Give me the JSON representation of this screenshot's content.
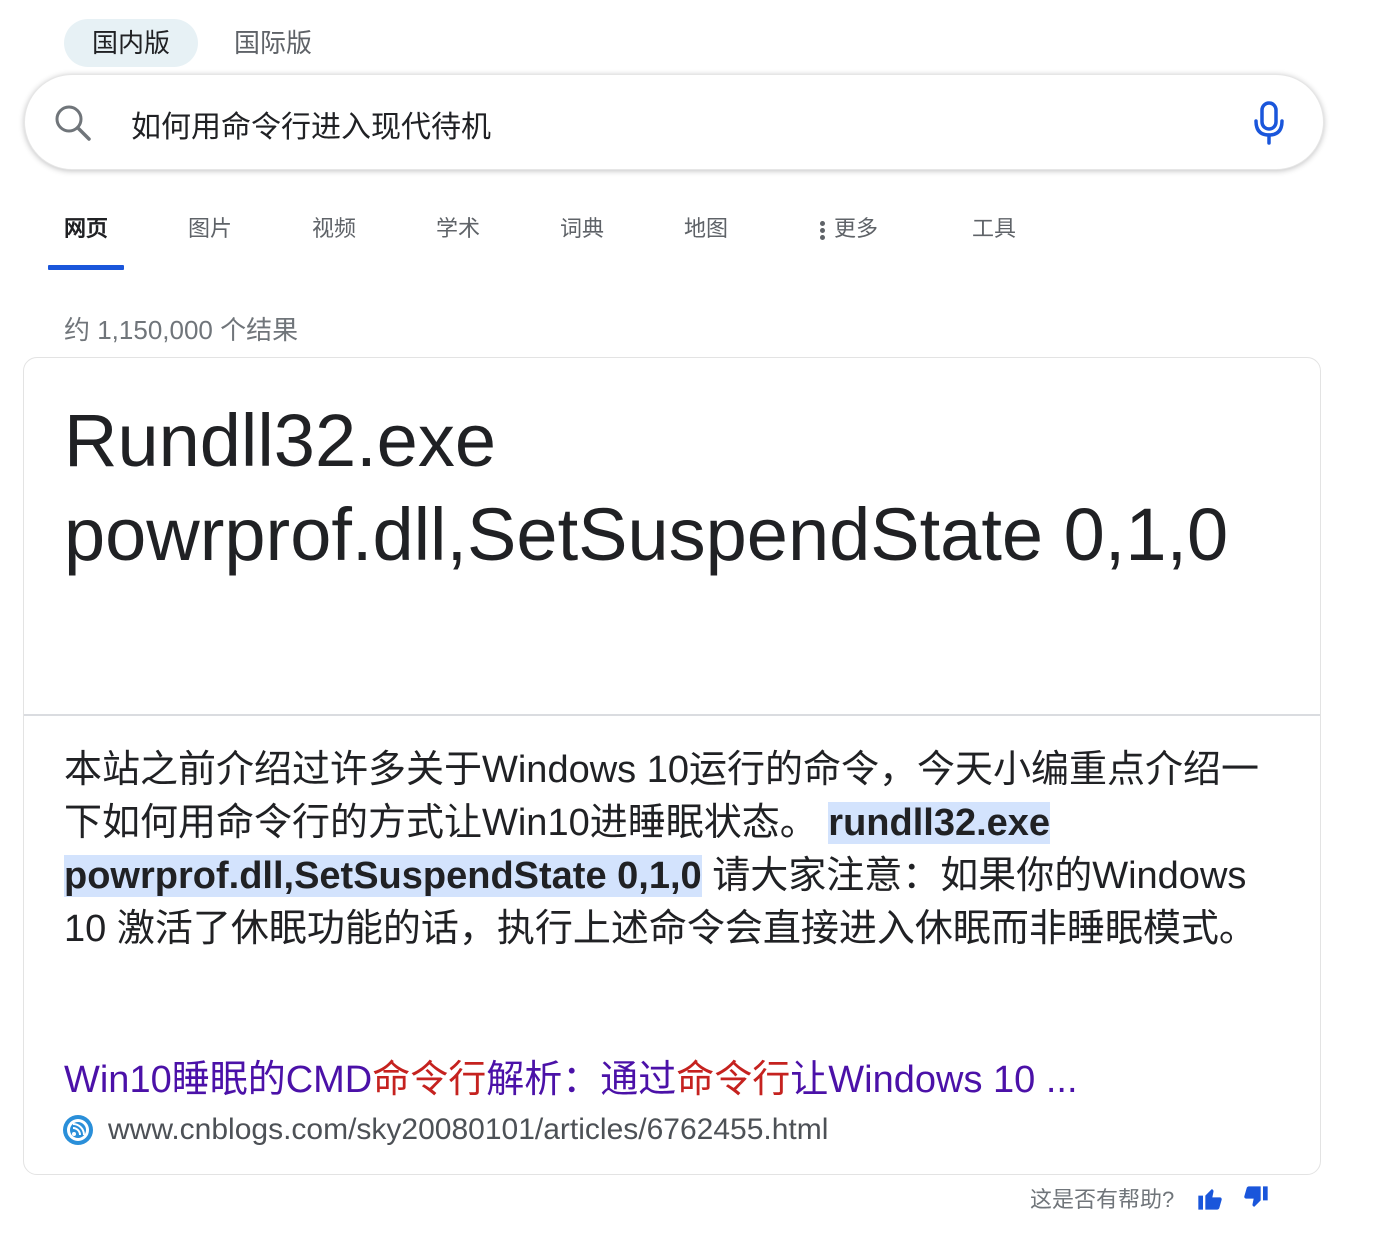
{
  "region_tabs": [
    {
      "label": "国内版",
      "active": true
    },
    {
      "label": "国际版",
      "active": false
    }
  ],
  "search": {
    "query": "如何用命令行进入现代待机",
    "icon": "search-icon",
    "mic_icon": "microphone-icon"
  },
  "nav": {
    "tabs": [
      "网页",
      "图片",
      "视频",
      "学术",
      "词典",
      "地图",
      "更多",
      "工具"
    ],
    "active": "网页",
    "accent": "#1a56db"
  },
  "result_count": "约 1,150,000 个结果",
  "answer": {
    "title": "Rundll32.exe powrprof.dll,SetSuspendState 0,1,0",
    "snippet_before": "本站之前介绍过许多关于Windows 10运行的命令，今天小编重点介绍一下如何用命令行的方式让Win10进睡眠状态。",
    "snippet_highlight": "rundll32.exe powrprof.dll,SetSuspendState 0,1,0",
    "snippet_after": "请大家注意：如果你的Windows 10 激活了休眠功能的话，执行上述命令会直接进入休眠而非睡眠模式。",
    "highlight_color": "#d3e3fd",
    "source": {
      "title_parts": [
        "Win10睡眠的CMD",
        "命令行",
        "解析：通过",
        "命令行",
        "让Windows 10 ..."
      ],
      "url": "www.cnblogs.com/sky20080101/articles/6762455.html",
      "favicon": "cnblogs-favicon",
      "link_color": "#4b11a8",
      "keyword_color": "#c5221f"
    }
  },
  "feedback": {
    "label": "这是否有帮助?",
    "up_icon": "thumbs-up-icon",
    "down_icon": "thumbs-down-icon",
    "icon_color": "#1a56db"
  }
}
